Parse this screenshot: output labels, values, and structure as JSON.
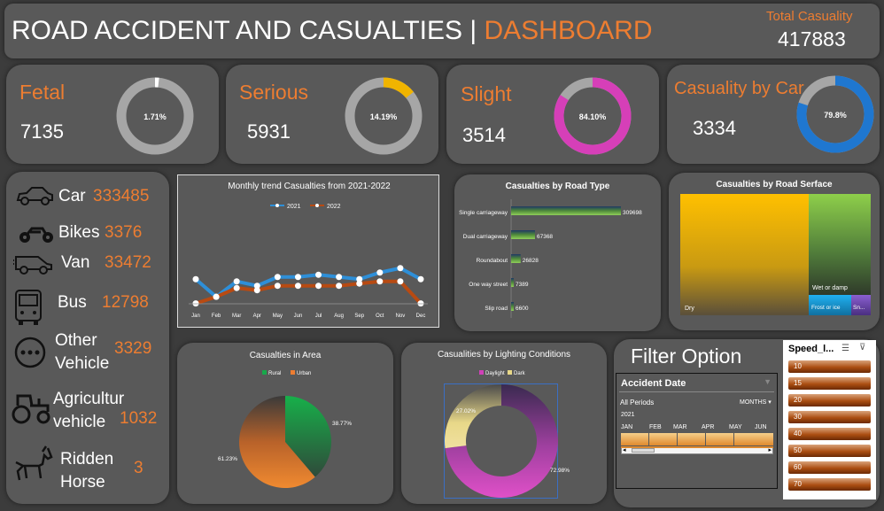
{
  "header": {
    "title_main": "ROAD ACCIDENT AND CASUALTIES",
    "separator": "|",
    "title_accent": "DASHBOARD",
    "total_label": "Total Casuality",
    "total_value": "417883"
  },
  "kpis": [
    {
      "title": "Fetal",
      "value": "7135",
      "pct_label": "1.71%",
      "pct": 0.0171,
      "color": "#ffffff"
    },
    {
      "title": "Serious",
      "value": "5931",
      "pct_label": "14.19%",
      "pct": 0.1419,
      "color": "#f0b400"
    },
    {
      "title": "Slight",
      "value": "3514",
      "pct_label": "84.10%",
      "pct": 0.841,
      "color": "#d63fb8"
    },
    {
      "title": "Casuality by Car",
      "value": "3334",
      "pct_label": "79.8%",
      "pct": 0.798,
      "color": "#1f77d0"
    }
  ],
  "vehicles": [
    {
      "label": "Car",
      "value": "333485",
      "icon": "car-icon"
    },
    {
      "label": "Bikes",
      "value": "3376",
      "icon": "motorbike-icon"
    },
    {
      "label": "Van",
      "value": "33472",
      "icon": "van-icon"
    },
    {
      "label": "Bus",
      "value": "12798",
      "icon": "bus-icon"
    },
    {
      "label_line1": "Other",
      "label_line2": "Vehicle",
      "value": "3329",
      "icon": "more-dots-icon"
    },
    {
      "label_line1": "Agricultur",
      "label_line2": "vehicle",
      "value": "1032",
      "icon": "tractor-icon"
    },
    {
      "label_line1": "Ridden",
      "label_line2": "Horse",
      "value": "3",
      "icon": "horse-icon"
    }
  ],
  "chart_data": [
    {
      "type": "line",
      "title": "Monthly trend Casualties from 2021-2022",
      "categories": [
        "Jan",
        "Feb",
        "Mar",
        "Apr",
        "May",
        "Jun",
        "Jul",
        "Aug",
        "Sep",
        "Oct",
        "Nov",
        "Dec"
      ],
      "series": [
        {
          "name": "2021",
          "color": "#2e8fd8",
          "values": [
            36000,
            28000,
            35000,
            33000,
            37000,
            37000,
            38000,
            37000,
            36000,
            39000,
            41000,
            36000
          ]
        },
        {
          "name": "2022",
          "color": "#b84a12",
          "values": [
            25000,
            28000,
            32000,
            31000,
            33000,
            33000,
            33000,
            33000,
            34000,
            35000,
            35000,
            25000
          ]
        }
      ],
      "ylim": [
        0,
        80000
      ],
      "legend": "top-center"
    },
    {
      "type": "bar",
      "title": "Casualties by Road Type",
      "categories": [
        "Single carriageway",
        "Dual carriageway",
        "Roundabout",
        "One way street",
        "Slip road"
      ],
      "values": [
        309698,
        67368,
        26828,
        7389,
        6600
      ],
      "orientation": "horizontal"
    },
    {
      "type": "heatmap",
      "title": "Casualties by Road Serface",
      "categories": [
        "Dry",
        "Wet or damp",
        "Frost or ice",
        "Sn..."
      ],
      "colors": [
        "#f5b800",
        "#7fc24a",
        "#1aa0e0",
        "#7a4fc0"
      ]
    },
    {
      "type": "pie",
      "title": "Casualties in Area",
      "categories": [
        "Rural",
        "Urban"
      ],
      "values": [
        38.77,
        61.23
      ],
      "labels": [
        "38.77%",
        "61.23%"
      ],
      "colors": [
        "#17a84a",
        "#ed7d31"
      ],
      "legend": "top-center"
    },
    {
      "type": "pie",
      "title": "Casualities by Lighting Conditions",
      "categories": [
        "Daylight",
        "Dark"
      ],
      "values": [
        72.98,
        27.02
      ],
      "labels": [
        "72.98%",
        "27.02%"
      ],
      "colors": [
        "#d040b8",
        "#e8d888"
      ],
      "legend": "top-center"
    }
  ],
  "filter": {
    "title": "Filter Option",
    "slicer_title": "Accident Date",
    "all_periods": "All Periods",
    "months_label": "MONTHS",
    "year": "2021",
    "months": [
      "JAN",
      "FEB",
      "MAR",
      "APR",
      "MAY",
      "JUN"
    ]
  },
  "speed": {
    "title": "Speed_l...",
    "items": [
      "10",
      "15",
      "20",
      "30",
      "40",
      "50",
      "60",
      "70"
    ]
  }
}
